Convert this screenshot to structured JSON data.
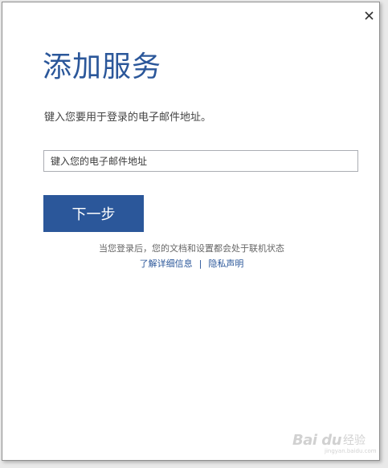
{
  "dialog": {
    "title": "添加服务",
    "instruction": "键入您要用于登录的电子邮件地址。",
    "email_input": {
      "value": "",
      "placeholder": "键入您的电子邮件地址"
    },
    "next_button_label": "下一步",
    "footer_note": "当您登录后，您的文档和设置都会处于联机状态",
    "links": {
      "learn_more": "了解详细信息",
      "separator": "|",
      "privacy": "隐私声明"
    },
    "close_icon": "close-icon"
  },
  "watermark": {
    "brand": "Bai du",
    "suffix": "经验",
    "url": "jingyan.baidu.com"
  },
  "colors": {
    "accent": "#2b579a",
    "text": "#444444",
    "muted": "#666666"
  }
}
